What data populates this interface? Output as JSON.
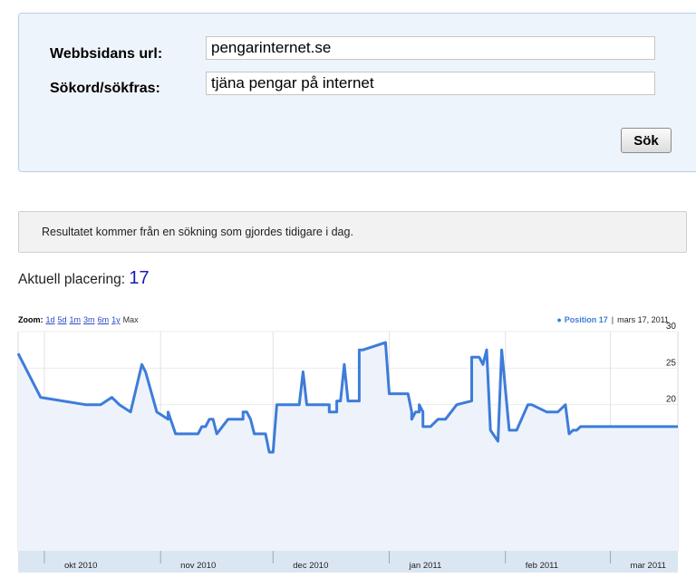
{
  "form": {
    "url_label": "Webbsidans url:",
    "url_value": "pengarinternet.se",
    "keyword_label": "Sökord/sökfras:",
    "keyword_value": "tjäna pengar på internet",
    "search_button": "Sök"
  },
  "info_message": "Resultatet kommer från en sökning som gjordes tidigare i dag.",
  "current_placement": {
    "label": "Aktuell placering:",
    "value": "17"
  },
  "chart_toolbar": {
    "zoom_label": "Zoom:",
    "zoom_options": [
      "1d",
      "5d",
      "1m",
      "3m",
      "6m",
      "1y"
    ],
    "zoom_max": "Max",
    "legend_series": "Position 17",
    "legend_separator": "|",
    "legend_date": "mars 17, 2011"
  },
  "colors": {
    "line": "#3d7cd9",
    "fill": "#eef3fb",
    "link": "#2a49c7",
    "placement_value": "#1a1ab8"
  },
  "chart_data": {
    "type": "area",
    "title": "",
    "xlabel": "",
    "ylabel": "",
    "ylim": [
      0,
      30
    ],
    "y_ticks": [
      0,
      5,
      10,
      15,
      20,
      25,
      30
    ],
    "x_tick_labels": [
      "okt 2010",
      "nov 2010",
      "dec 2010",
      "jan 2011",
      "feb 2011",
      "mar 2011"
    ],
    "x_tick_dates": [
      "2010-10-01",
      "2010-11-01",
      "2010-12-01",
      "2011-01-01",
      "2011-02-01",
      "2011-03-01"
    ],
    "x_range": [
      "2010-09-24",
      "2011-03-19"
    ],
    "grid": true,
    "legend": "top-right",
    "series": [
      {
        "name": "Position",
        "x": [
          "2010-09-24",
          "2010-09-30",
          "2010-10-12",
          "2010-10-16",
          "2010-10-19",
          "2010-10-21",
          "2010-10-24",
          "2010-10-27",
          "2010-10-28",
          "2010-10-31",
          "2010-11-03",
          "2010-11-03",
          "2010-11-05",
          "2010-11-11",
          "2010-11-12",
          "2010-11-13",
          "2010-11-14",
          "2010-11-15",
          "2010-11-16",
          "2010-11-19",
          "2010-11-23",
          "2010-11-23",
          "2010-11-24",
          "2010-11-25",
          "2010-11-26",
          "2010-11-29",
          "2010-11-30",
          "2010-12-01",
          "2010-12-02",
          "2010-12-08",
          "2010-12-09",
          "2010-12-09",
          "2010-12-10",
          "2010-12-16",
          "2010-12-16",
          "2010-12-18",
          "2010-12-18",
          "2010-12-19",
          "2010-12-20",
          "2010-12-20",
          "2010-12-21",
          "2010-12-24",
          "2010-12-24",
          "2010-12-25",
          "2010-12-25",
          "2010-12-31",
          "2011-01-01",
          "2011-01-06",
          "2011-01-07",
          "2011-01-07",
          "2011-01-08",
          "2011-01-09",
          "2011-01-09",
          "2011-01-10",
          "2011-01-10",
          "2011-01-12",
          "2011-01-14",
          "2011-01-16",
          "2011-01-19",
          "2011-01-23",
          "2011-01-23",
          "2011-01-25",
          "2011-01-26",
          "2011-01-27",
          "2011-01-28",
          "2011-01-30",
          "2011-01-31",
          "2011-02-02",
          "2011-02-04",
          "2011-02-07",
          "2011-02-08",
          "2011-02-12",
          "2011-02-15",
          "2011-02-17",
          "2011-02-18",
          "2011-02-19",
          "2011-02-20",
          "2011-02-21",
          "2011-02-22",
          "2011-02-24",
          "2011-02-27",
          "2011-03-01",
          "2011-03-02",
          "2011-03-04",
          "2011-03-06",
          "2011-03-07",
          "2011-03-08",
          "2011-03-10",
          "2011-03-11",
          "2011-03-12",
          "2011-03-14",
          "2011-03-15",
          "2011-03-17",
          "2011-03-19"
        ],
        "values": [
          27,
          21,
          20,
          20,
          21,
          20,
          19,
          25.5,
          24.5,
          19,
          18,
          19,
          16,
          16,
          17,
          17,
          18,
          18,
          16,
          18,
          18,
          19,
          19,
          18,
          16,
          16,
          13.5,
          13.5,
          20,
          20,
          24.5,
          24.5,
          20,
          20,
          19,
          19,
          20.5,
          20.5,
          25.5,
          25.5,
          20.5,
          20.5,
          27.5,
          27.5,
          27.5,
          28.5,
          21.5,
          21.5,
          19,
          18,
          19,
          19,
          20,
          19,
          17,
          17,
          18,
          18,
          20,
          20.5,
          26.5,
          26.5,
          25.5,
          27.5,
          16.5,
          15,
          27.5,
          16.5,
          16.5,
          20,
          20,
          19,
          19,
          20,
          16,
          16.5,
          16.5,
          17,
          17,
          17,
          17,
          17,
          17,
          17,
          17,
          17,
          17,
          17,
          17,
          17,
          17,
          17,
          17,
          17
        ]
      }
    ]
  }
}
